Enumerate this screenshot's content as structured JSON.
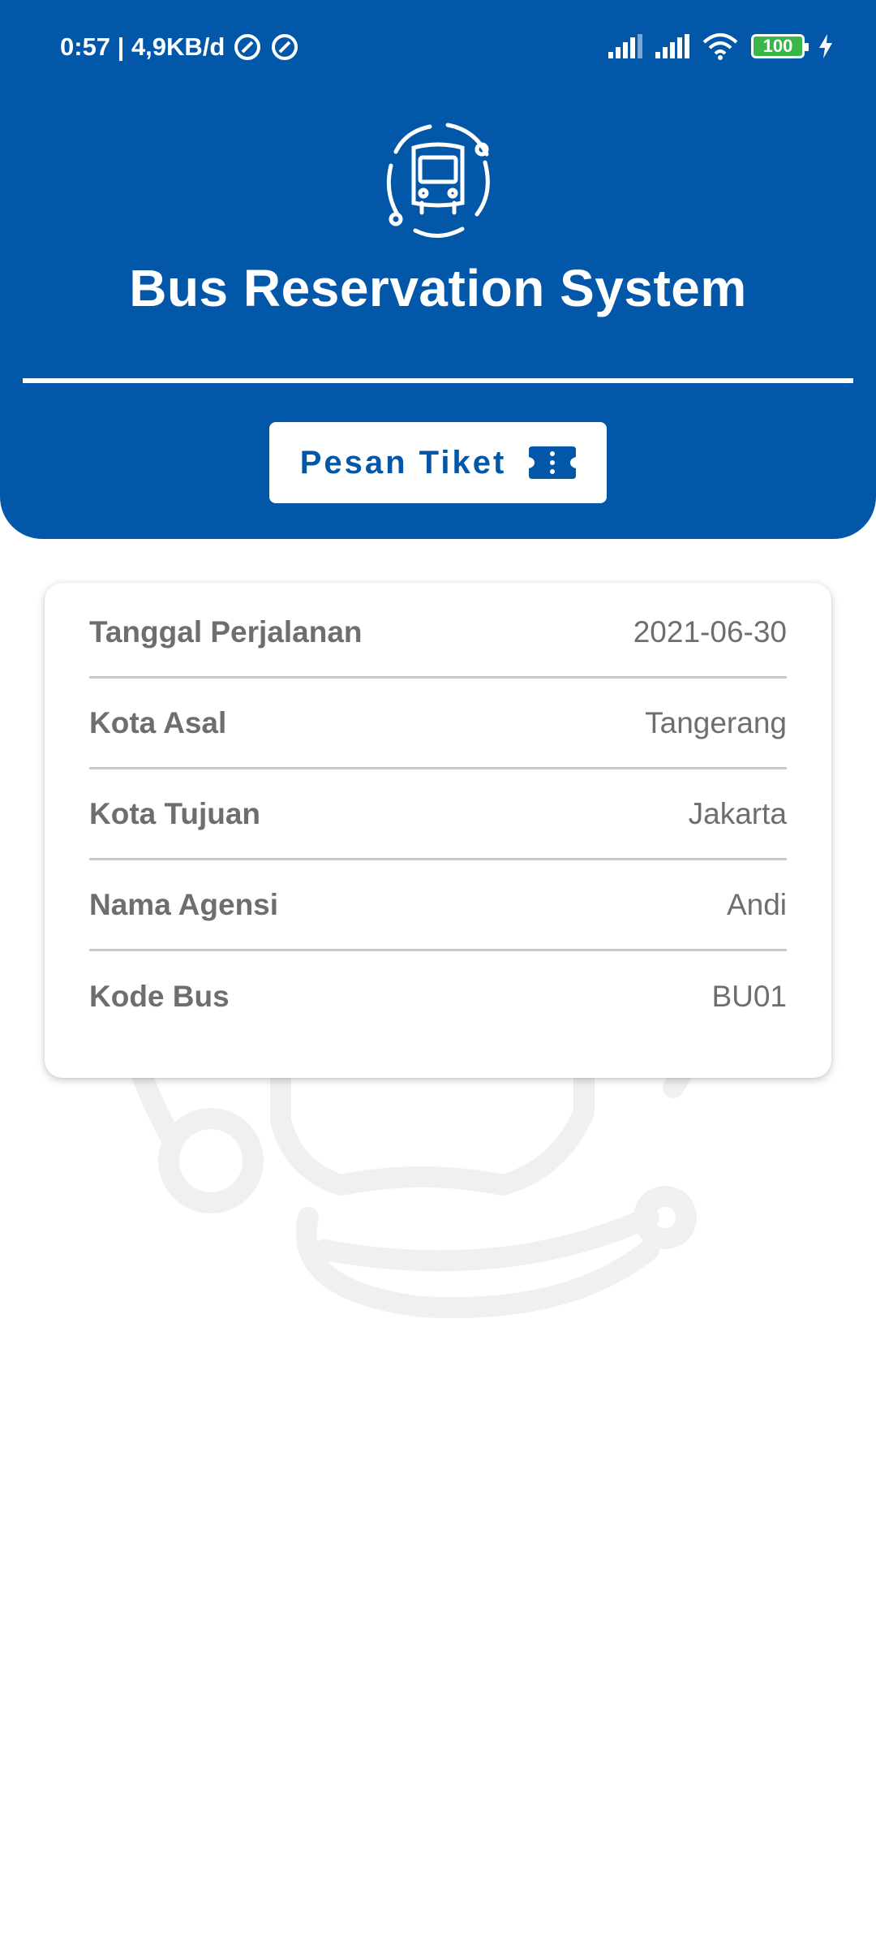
{
  "status_bar": {
    "text": "0:57 | 4,9KB/d",
    "battery": "100"
  },
  "header": {
    "title": "Bus Reservation System",
    "order_button_label": "Pesan Tiket"
  },
  "trip_details": [
    {
      "label": "Tanggal Perjalanan",
      "value": "2021-06-30"
    },
    {
      "label": "Kota Asal",
      "value": "Tangerang"
    },
    {
      "label": "Kota Tujuan",
      "value": "Jakarta"
    },
    {
      "label": "Nama Agensi",
      "value": "Andi"
    },
    {
      "label": "Kode Bus",
      "value": "BU01"
    }
  ],
  "colors": {
    "primary": "#0257a8",
    "background": "#ffffff",
    "text_muted": "#6e6e6e"
  },
  "icons": [
    "bus-logo-icon",
    "ticket-icon",
    "signal-icon",
    "wifi-icon",
    "battery-icon",
    "charging-icon"
  ]
}
